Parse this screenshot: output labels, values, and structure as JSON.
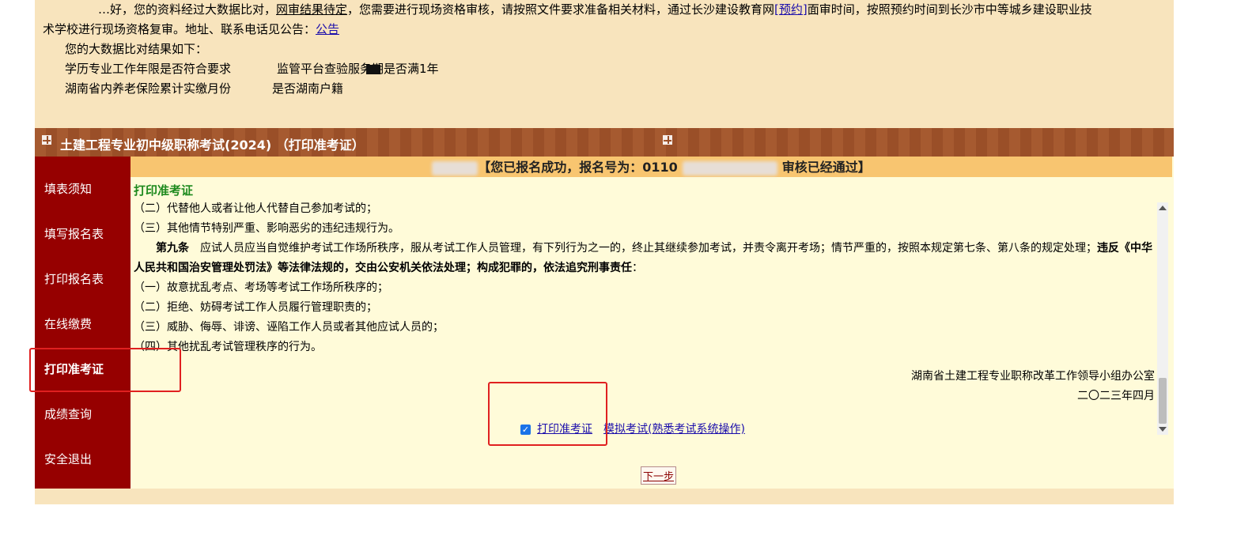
{
  "notice": {
    "line1_a": "…好，您的资料经过大数据比对，",
    "line1_b": "网审结果待定",
    "line1_c": "，您需要进行现场资格审核，请按照文件要求准备相关材料，通过长沙建设教育网",
    "line1_link": "[预约]",
    "line1_d": "面审时间，按照预约时间到长沙市中等城乡建设职业技",
    "line2": "术学校进行现场资格复审。地址、联系电话见公告：",
    "line2_link": "公告",
    "result_intro": "您的大数据比对结果如下：",
    "q1": "学历专业工作年限是否符合要求",
    "q2": "监管平台查验服务期是否满1年",
    "q3": "湖南省内养老保险累计实缴月份",
    "q4": "是否湖南户籍"
  },
  "banner": {
    "title": "土建工程专业初中级职称考试(2024) （打印准考证）"
  },
  "sidebar": {
    "items": [
      {
        "label": "填表须知"
      },
      {
        "label": "填写报名表"
      },
      {
        "label": "打印报名表"
      },
      {
        "label": "在线缴费"
      },
      {
        "label": "打印准考证"
      },
      {
        "label": "成绩查询"
      },
      {
        "label": "安全退出"
      }
    ]
  },
  "status": {
    "part1": "【您已报名成功，报名号为：0110",
    "part2": "审核已经通过】"
  },
  "section_title": "打印准考证",
  "rules": {
    "l1": "（二）代替他人或者让他人代替自己参加考试的；",
    "l2": "（三）其他情节特别严重、影响恶劣的违纪违规行为。",
    "art9_head": "第九条",
    "art9_a": "　应试人员应当自觉维护考试工作场所秩序，服从考试工作人员管理，有下列行为之一的，终止其继续参加考试，并责令离开考场；情节严重的，按照本规定第七条、第八条的规定处理；",
    "art9_b": "违反《中华人民共和国治安管理处罚法》等法律法规的，交由公安机关依法处理；构成犯罪的，依法追究刑事责任",
    "art9_c": "：",
    "l3": "（一）故意扰乱考点、考场等考试工作场所秩序的；",
    "l4": "（二）拒绝、妨碍考试工作人员履行管理职责的；",
    "l5": "（三）威胁、侮辱、诽谤、诬陷工作人员或者其他应试人员的；",
    "l6": "（四）其他扰乱考试管理秩序的行为。"
  },
  "signature": {
    "org": "湖南省土建工程专业职称改革工作领导小组办公室",
    "date": "二〇二三年四月"
  },
  "links": {
    "print_admission": "打印准考证",
    "mock_exam": "模拟考试(熟悉考试系统操作)"
  },
  "buttons": {
    "next": "下一步"
  },
  "colors": {
    "sidebar_bg": "#960000",
    "banner_bg": "#a65a30",
    "status_bg": "#f8c570",
    "notice_bg": "#f8e4bd",
    "annotation": "#e02020"
  },
  "icons": {
    "checkbox": "checked-checkbox-icon",
    "banner": "grid-icon"
  }
}
